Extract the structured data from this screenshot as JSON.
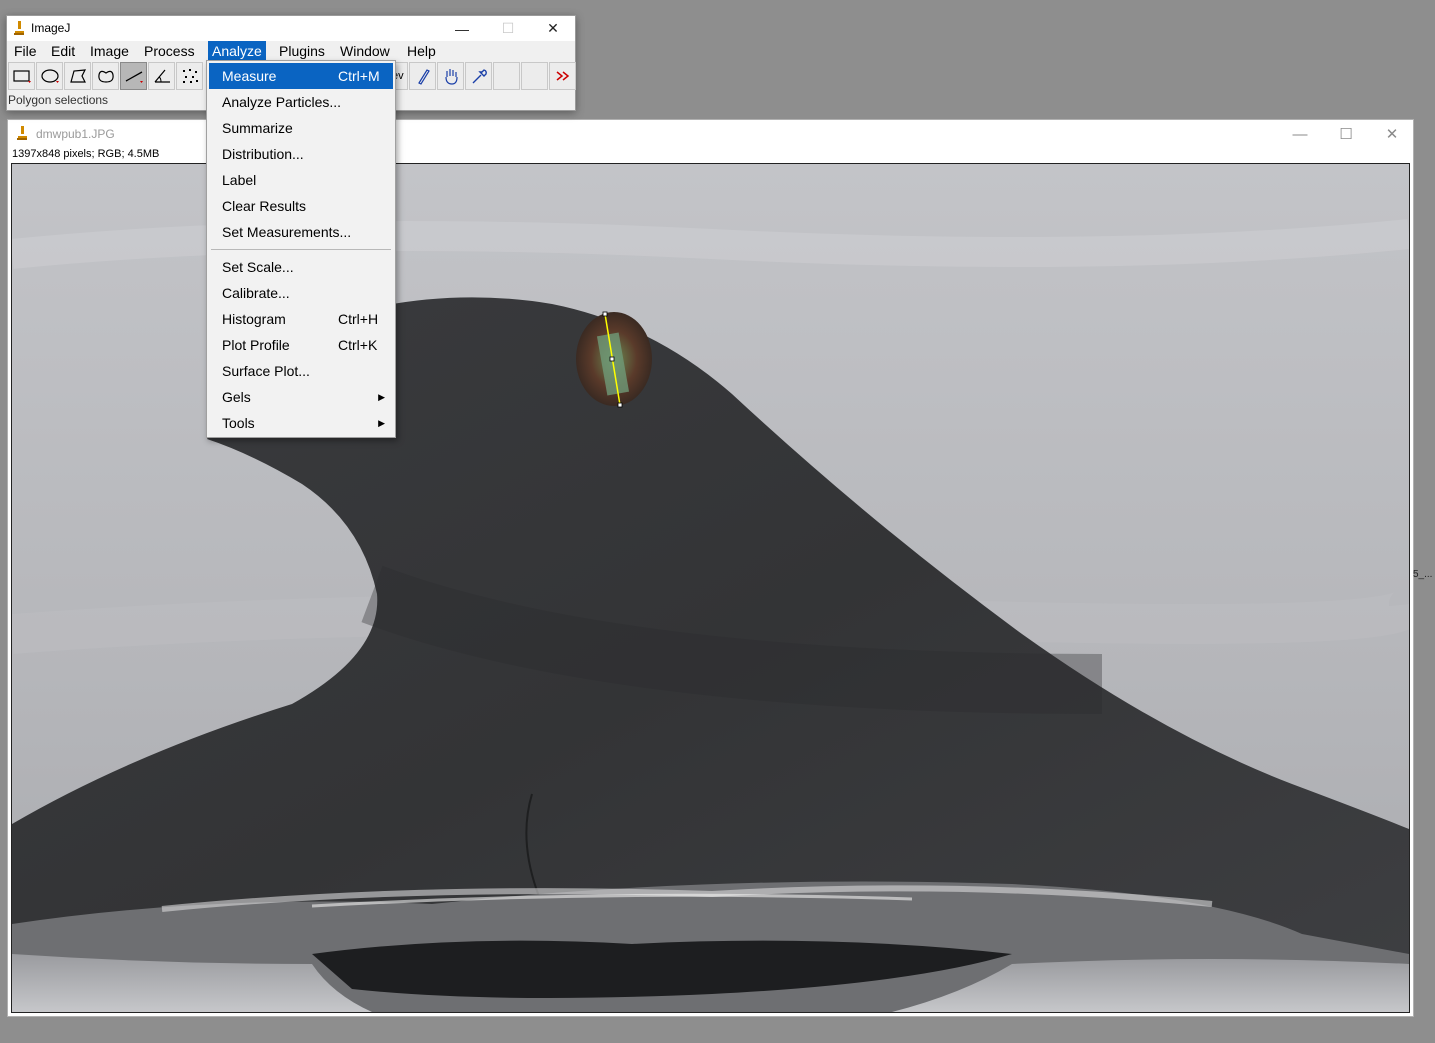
{
  "image_window": {
    "title": "dmwpub1.JPG",
    "info": "1397x848 pixels; RGB; 4.5MB"
  },
  "main_window": {
    "title": "ImageJ",
    "menu": [
      "File",
      "Edit",
      "Image",
      "Process",
      "Analyze",
      "Plugins",
      "Window",
      "Help"
    ],
    "status": "Polygon selections",
    "toolbar_partial_label": "ev"
  },
  "window_controls": {
    "minimize": "—",
    "maximize": "☐",
    "close": "✕"
  },
  "analyze_menu": {
    "items": [
      {
        "label": "Measure",
        "shortcut": "Ctrl+M"
      },
      {
        "label": "Analyze Particles...",
        "shortcut": ""
      },
      {
        "label": "Summarize",
        "shortcut": ""
      },
      {
        "label": "Distribution...",
        "shortcut": ""
      },
      {
        "label": "Label",
        "shortcut": ""
      },
      {
        "label": "Clear Results",
        "shortcut": ""
      },
      {
        "label": "Set Measurements...",
        "shortcut": ""
      },
      {
        "label": "Set Scale...",
        "shortcut": ""
      },
      {
        "label": "Calibrate...",
        "shortcut": ""
      },
      {
        "label": "Histogram",
        "shortcut": "Ctrl+H"
      },
      {
        "label": "Plot Profile",
        "shortcut": "Ctrl+K"
      },
      {
        "label": "Surface Plot...",
        "shortcut": ""
      },
      {
        "label": "Gels",
        "shortcut": ""
      },
      {
        "label": "Tools",
        "shortcut": ""
      }
    ]
  },
  "background_text": "5_...",
  "colors": {
    "accent": "#0a64c2",
    "selection_line": "#ffff00",
    "desktop": "#8e8e8e"
  },
  "icons": {
    "app": "microscope-icon",
    "submenu": "arrow-right-icon",
    "more_tools": "double-chevron-right-icon"
  }
}
